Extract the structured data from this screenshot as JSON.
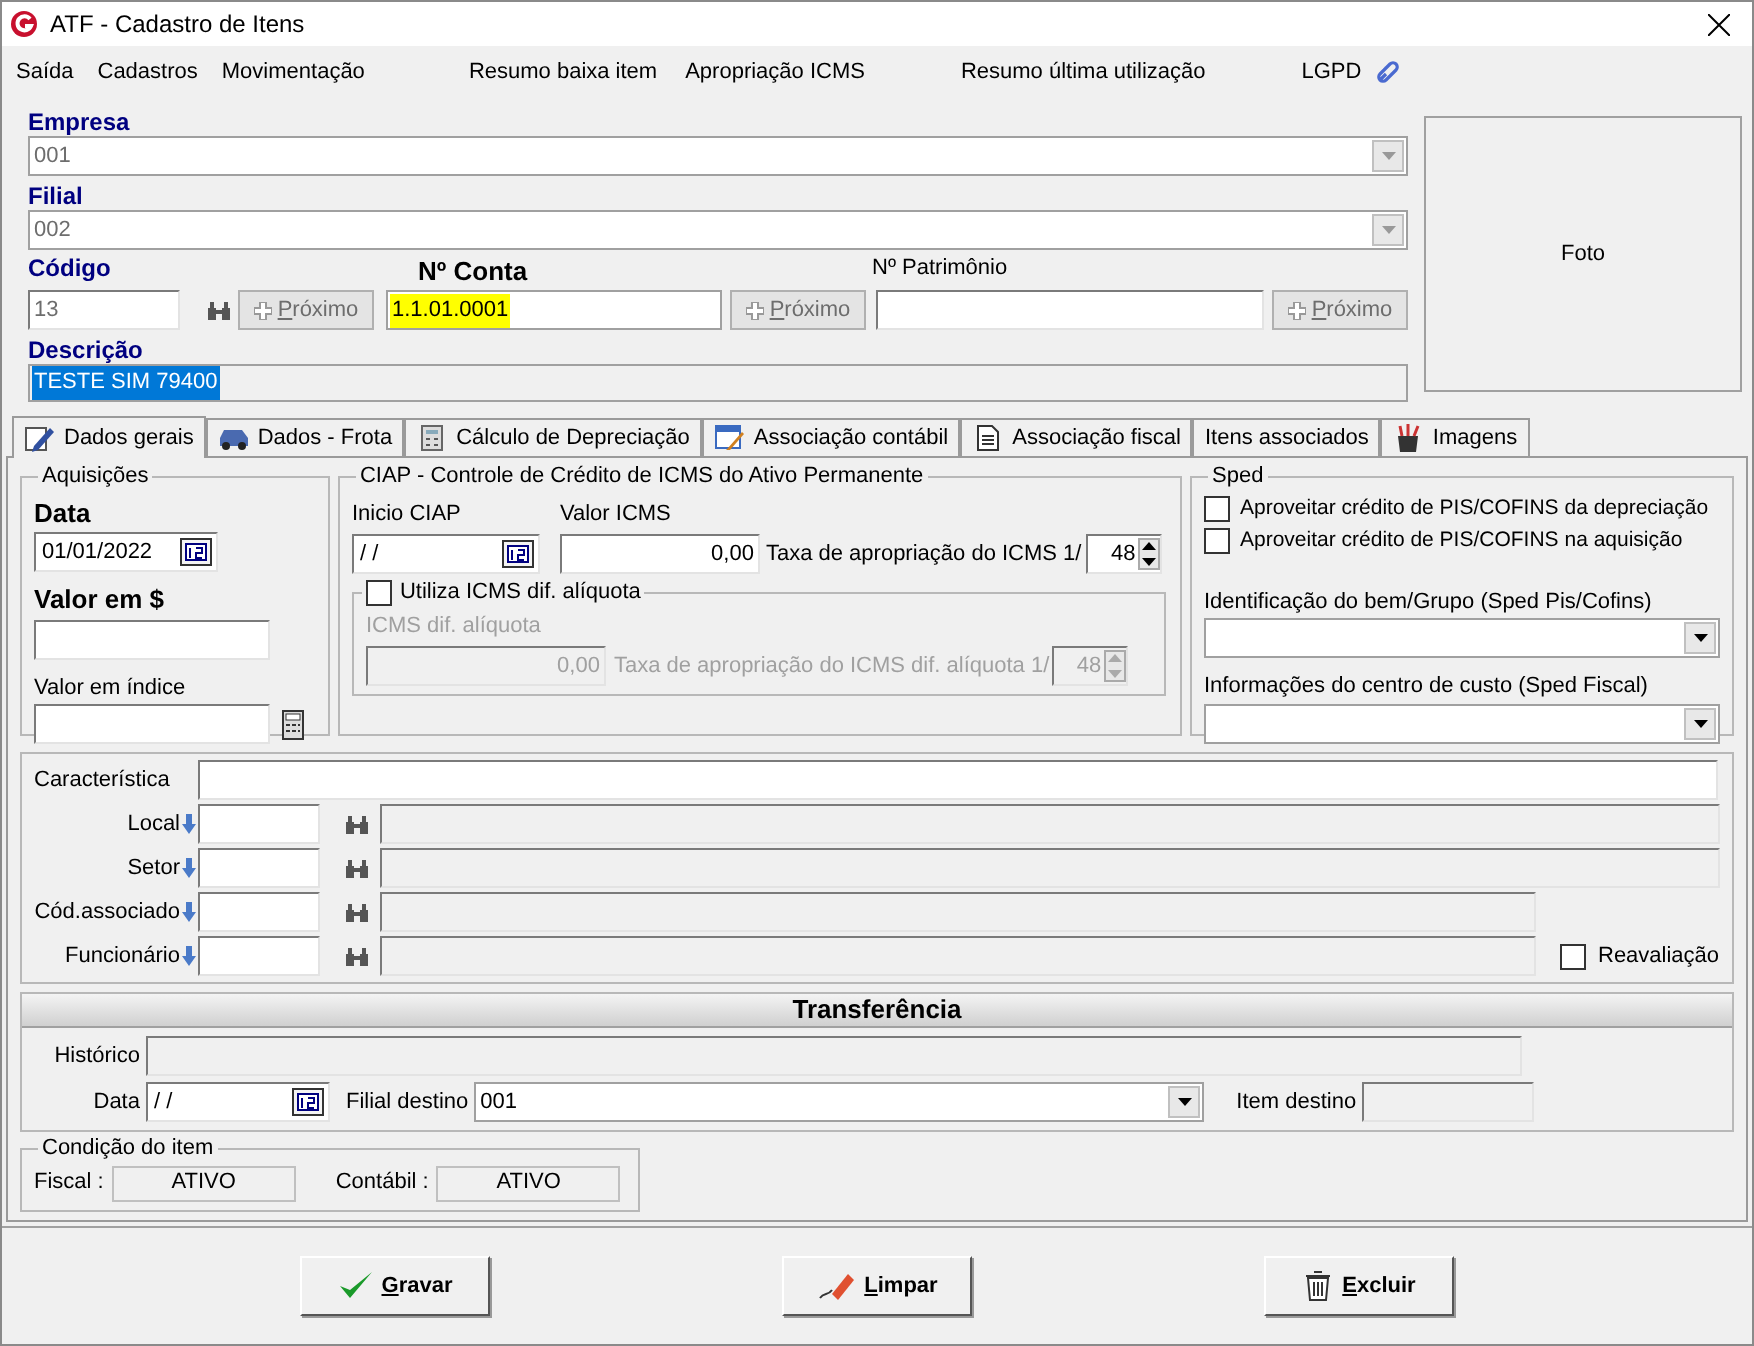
{
  "window": {
    "title": "ATF - Cadastro de Itens"
  },
  "menu": [
    {
      "label": "Saída",
      "kind": "text"
    },
    {
      "label": "Cadastros",
      "kind": "text"
    },
    {
      "label": "Movimentação",
      "kind": "text"
    },
    {
      "label": "Resumo baixa item",
      "kind": "text"
    },
    {
      "label": "Apropriação ICMS",
      "kind": "text"
    },
    {
      "label": "Resumo última utilização",
      "kind": "text"
    },
    {
      "label": "LGPD",
      "kind": "link"
    }
  ],
  "header": {
    "empresa": {
      "label": "Empresa",
      "value": "001"
    },
    "filial": {
      "label": "Filial",
      "value": "002"
    },
    "codigo": {
      "label": "Código",
      "value": "13"
    },
    "conta": {
      "label": "Nº Conta",
      "value": "1.1.01.0001"
    },
    "patrimonio": {
      "label": "Nº Patrimônio"
    },
    "next_buttons": [
      "Próximo",
      "Próximo",
      "Próximo"
    ],
    "descricao": {
      "label": "Descrição",
      "value": "TESTE SIM 79400",
      "selected": true
    },
    "photo": "Foto"
  },
  "tabs": [
    {
      "label": "Dados gerais",
      "kind": "pencil",
      "selected": true
    },
    {
      "label": "Dados - Frota",
      "kind": "car",
      "selected": false
    },
    {
      "label": "Cálculo de Depreciação",
      "kind": "calculator",
      "selected": false
    },
    {
      "label": "Associação contábil",
      "kind": "sheet",
      "selected": false
    },
    {
      "label": "Associação fiscal",
      "kind": "document",
      "selected": false
    },
    {
      "label": "Itens associados",
      "kind": "plain",
      "selected": false
    },
    {
      "label": "Imagens",
      "kind": "paint",
      "selected": false
    }
  ],
  "aquisicoes": {
    "title": "Aquisições",
    "data_label": "Data",
    "data_value": "01/01/2022",
    "valor_label": "Valor em $",
    "indice_label": "Valor em índice"
  },
  "ciap": {
    "title": "CIAP - Controle de Crédito de ICMS do Ativo Permanente",
    "inicio_label": "Inicio CIAP",
    "inicio_value": "/ /",
    "valor_label": "Valor ICMS",
    "valor_value": "0,00",
    "taxa_label": "Taxa de apropriação do ICMS 1/",
    "taxa_value": "48",
    "dif": {
      "label": "Utiliza ICMS dif. alíquota",
      "checked": false
    },
    "dif_label": "ICMS dif. alíquota",
    "dif_value": "0,00",
    "dif_taxa_label": "Taxa de apropriação do ICMS dif. alíquota 1/",
    "dif_taxa_value": "48",
    "dif_disabled": true
  },
  "sped": {
    "title": "Sped",
    "checks": [
      {
        "label": "Aproveitar crédito de PIS/COFINS da depreciação",
        "checked": false
      },
      {
        "label": "Aproveitar crédito de PIS/COFINS na aquisição",
        "checked": false
      }
    ],
    "combos": [
      {
        "label": "Identificação do bem/Grupo (Sped Pis/Cofins)"
      },
      {
        "label": "Informações do centro de custo (Sped Fiscal)"
      }
    ]
  },
  "details": {
    "caracteristica": "Característica",
    "lookups": [
      {
        "label": "Local",
        "wide": true
      },
      {
        "label": "Setor",
        "wide": true
      },
      {
        "label": "Cód.associado",
        "wide": false
      },
      {
        "label": "Funcionário",
        "wide": false
      }
    ],
    "reavaliacao": {
      "label": "Reavaliação",
      "checked": false
    }
  },
  "transfer": {
    "title": "Transferência",
    "historico": "Histórico",
    "data_label": "Data",
    "data_value": "/ /",
    "filial_label": "Filial destino",
    "filial_value": "001",
    "item_label": "Item destino"
  },
  "condicao": {
    "title": "Condição do item",
    "fiscal_label": "Fiscal :",
    "fiscal_value": "ATIVO",
    "contabil_label": "Contábil :",
    "contabil_value": "ATIVO"
  },
  "buttons": [
    {
      "label": "Gravar",
      "kind": "check"
    },
    {
      "label": "Limpar",
      "kind": "eraser"
    },
    {
      "label": "Excluir",
      "kind": "trash"
    }
  ]
}
